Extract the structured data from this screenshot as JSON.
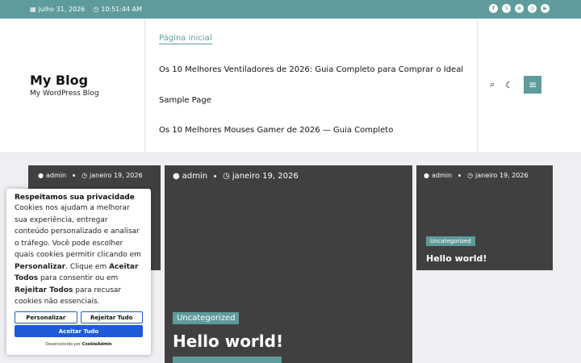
{
  "topbar": {
    "date": "julho 31, 2026",
    "time": "10:51:44 AM",
    "social": [
      {
        "icon": "facebook-icon",
        "glyph": "f"
      },
      {
        "icon": "x-icon",
        "glyph": "𝕏"
      },
      {
        "icon": "dribbble-icon",
        "glyph": "⊛"
      },
      {
        "icon": "instagram-icon",
        "glyph": "◎"
      },
      {
        "icon": "youtube-icon",
        "glyph": "▶"
      }
    ]
  },
  "brand": {
    "title": "My Blog",
    "tagline": "My WordPress Blog"
  },
  "nav": [
    "Página inicial",
    "Os 10 Melhores Ventiladores de 2026: Guia Completo para Comprar o Ideal",
    "Sample Page",
    " Os 10 Melhores Mouses Gamer de 2026 — Guia Completo"
  ],
  "tools": {
    "search": "⌕",
    "theme": "☾",
    "menu": "≡"
  },
  "posts": [
    {
      "author": "admin",
      "date": "janeiro 19, 2026"
    },
    {
      "author": "admin",
      "date": "janeiro 19, 2026",
      "category": "Uncategorized",
      "title": "Hello world!"
    },
    {
      "author": "admin",
      "date": "janeiro 19, 2026",
      "category": "Uncategorized",
      "title": "Hello world!"
    }
  ],
  "cookie": {
    "title": "Respeitamos sua privacidade",
    "text_1": "Cookies nos ajudam a melhorar sua experiência, entregar conteúdo personalizado e analisar o tráfego. Você pode escolher quais cookies permitir clicando em ",
    "bold_1": "Personalizar",
    "text_2": ". Clique em ",
    "bold_2": "Aceitar Todos",
    "text_3": " para consentir ou em ",
    "bold_3": "Rejeitar Todos",
    "text_4": " para recusar cookies não essenciais.",
    "customize": "Personalizar",
    "reject": "Rejeitar Tudo",
    "accept": "Aceitar Tudo",
    "powered_prefix": "Desenvolvido por",
    "powered_brand": "CookieAdmin"
  }
}
